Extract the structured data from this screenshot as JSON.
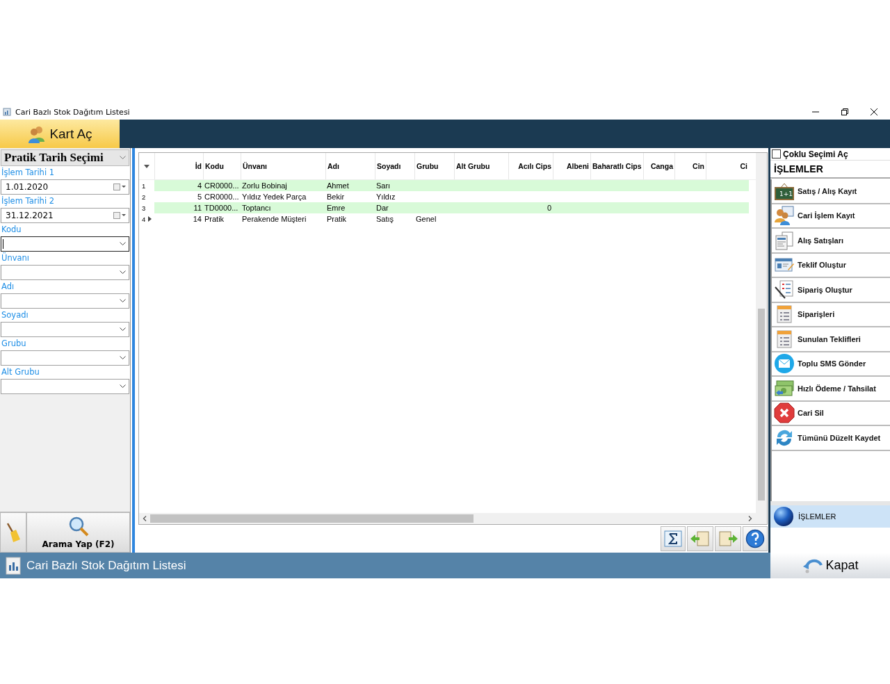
{
  "window": {
    "title": "Cari Bazlı Stok Dağıtım Listesi"
  },
  "toolbar": {
    "open_card_button": "Kart Aç"
  },
  "filter_panel": {
    "title": "Pratik Tarih Seçimi",
    "fields": [
      {
        "kind": "date",
        "label": "İşlem Tarihi 1",
        "value": "1.01.2020"
      },
      {
        "kind": "date",
        "label": "İşlem Tarihi 2",
        "value": "31.12.2021"
      },
      {
        "kind": "combo",
        "label": "Kodu",
        "focused": true
      },
      {
        "kind": "combo",
        "label": "Ünvanı",
        "focused": false
      },
      {
        "kind": "combo",
        "label": "Adı",
        "focused": false
      },
      {
        "kind": "combo",
        "label": "Soyadı",
        "focused": false
      },
      {
        "kind": "combo",
        "label": "Grubu",
        "focused": false
      },
      {
        "kind": "combo",
        "label": "Alt Grubu",
        "focused": false
      }
    ],
    "search_button": "Arama Yap (F2)"
  },
  "table": {
    "columns": [
      "İd",
      "Kodu",
      "Ünvanı",
      "Adı",
      "Soyadı",
      "Grubu",
      "Alt Grubu",
      "Acılı Cips",
      "Albeni",
      "Baharatlı Cips",
      "Canga",
      "Cin",
      "Ci"
    ],
    "rows": [
      {
        "number": "1",
        "current": false,
        "cells": [
          "4",
          "CR0000...",
          "Zorlu Bobinaj",
          "Ahmet",
          "Sarı",
          "",
          "",
          "",
          "",
          "",
          "",
          "",
          ""
        ]
      },
      {
        "number": "2",
        "current": false,
        "cells": [
          "5",
          "CR0000...",
          "Yıldız Yedek Parça",
          "Bekir",
          "Yıldız",
          "",
          "",
          "",
          "",
          "",
          "",
          "",
          ""
        ]
      },
      {
        "number": "3",
        "current": false,
        "cells": [
          "11",
          "TD0000...",
          "Toptancı",
          "Emre",
          "Dar",
          "",
          "",
          "0",
          "",
          "",
          "",
          "",
          ""
        ]
      },
      {
        "number": "4",
        "current": true,
        "cells": [
          "14",
          "Pratik",
          "Perakende Müşteri",
          "Pratik",
          "Satış",
          "Genel",
          "",
          "",
          "",
          "",
          "",
          "",
          ""
        ]
      }
    ]
  },
  "actions_panel": {
    "multi_select": {
      "label": "Çoklu Seçimi Aç",
      "checked": false
    },
    "title": "İŞLEMLER",
    "items": [
      {
        "kind": "board",
        "label": "Satış / Alış Kayıt",
        "icon_text": "1+1"
      },
      {
        "kind": "people",
        "label": "Cari İşlem Kayıt"
      },
      {
        "kind": "forms",
        "label": "Alış Satışları"
      },
      {
        "kind": "card",
        "label": "Teklif Oluştur"
      },
      {
        "kind": "checklist",
        "label": "Sipariş Oluştur"
      },
      {
        "kind": "doc",
        "label": "Siparişleri"
      },
      {
        "kind": "doc",
        "label": "Sunulan Teklifleri"
      },
      {
        "kind": "mail",
        "label": "Toplu SMS Gönder"
      },
      {
        "kind": "money",
        "label": "Hızlı Ödeme / Tahsilat"
      },
      {
        "kind": "delete",
        "label": "Cari Sil"
      },
      {
        "kind": "refresh",
        "label": "Tümünü Düzelt Kaydet"
      }
    ],
    "nav": [
      {
        "label": "İŞLEMLER",
        "selected": true
      }
    ]
  },
  "status_bar": {
    "title": "Cari Bazlı Stok Dağıtım Listesi",
    "close_button": "Kapat"
  }
}
